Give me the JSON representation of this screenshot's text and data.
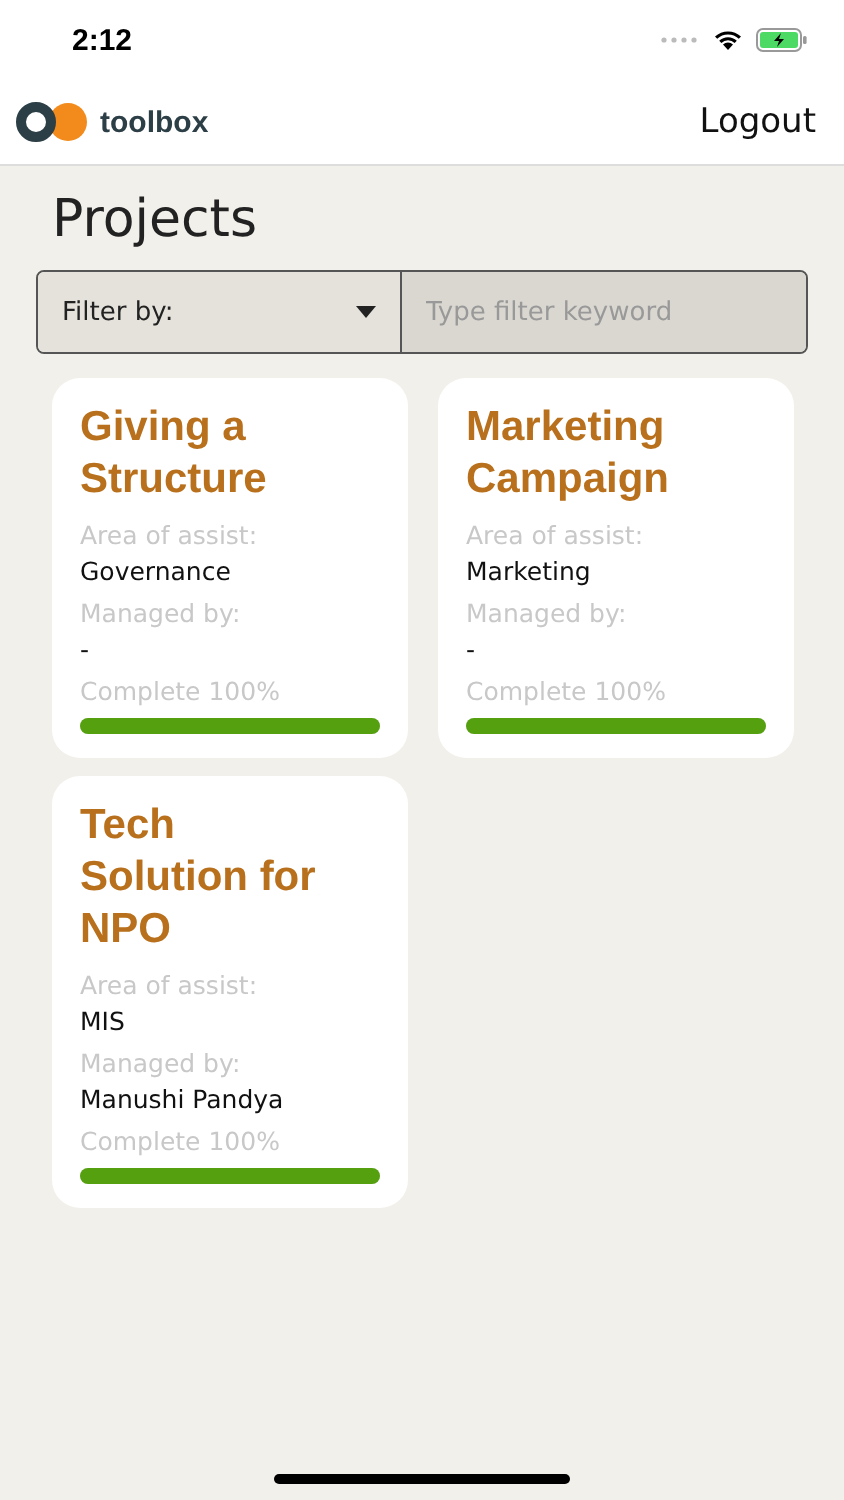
{
  "status_bar": {
    "time": "2:12"
  },
  "header": {
    "brand": "toolbox",
    "logout": "Logout"
  },
  "page_title": "Projects",
  "filter": {
    "dropdown": "Filter by:",
    "placeholder": "Type filter keyword"
  },
  "projects": [
    {
      "title": "Giving a Structure",
      "area_label": "Area of assist:",
      "area": "Governance",
      "manager_label": "Managed by:",
      "manager": "-",
      "complete": "Complete 100%",
      "level": 1
    },
    {
      "title": "Marketing Campaign",
      "area_label": "Area of assist:",
      "area": "Marketing",
      "manager_label": "Managed by:",
      "manager": "-",
      "complete": "Complete 100%",
      "level": 1
    },
    {
      "title": "Tech Solution for NPO",
      "area_label": "Area of assist:",
      "area": "MIS",
      "manager_label": "Managed by:",
      "manager": "Manushi Pandya",
      "complete": "Complete 100%",
      "level": 1
    }
  ]
}
